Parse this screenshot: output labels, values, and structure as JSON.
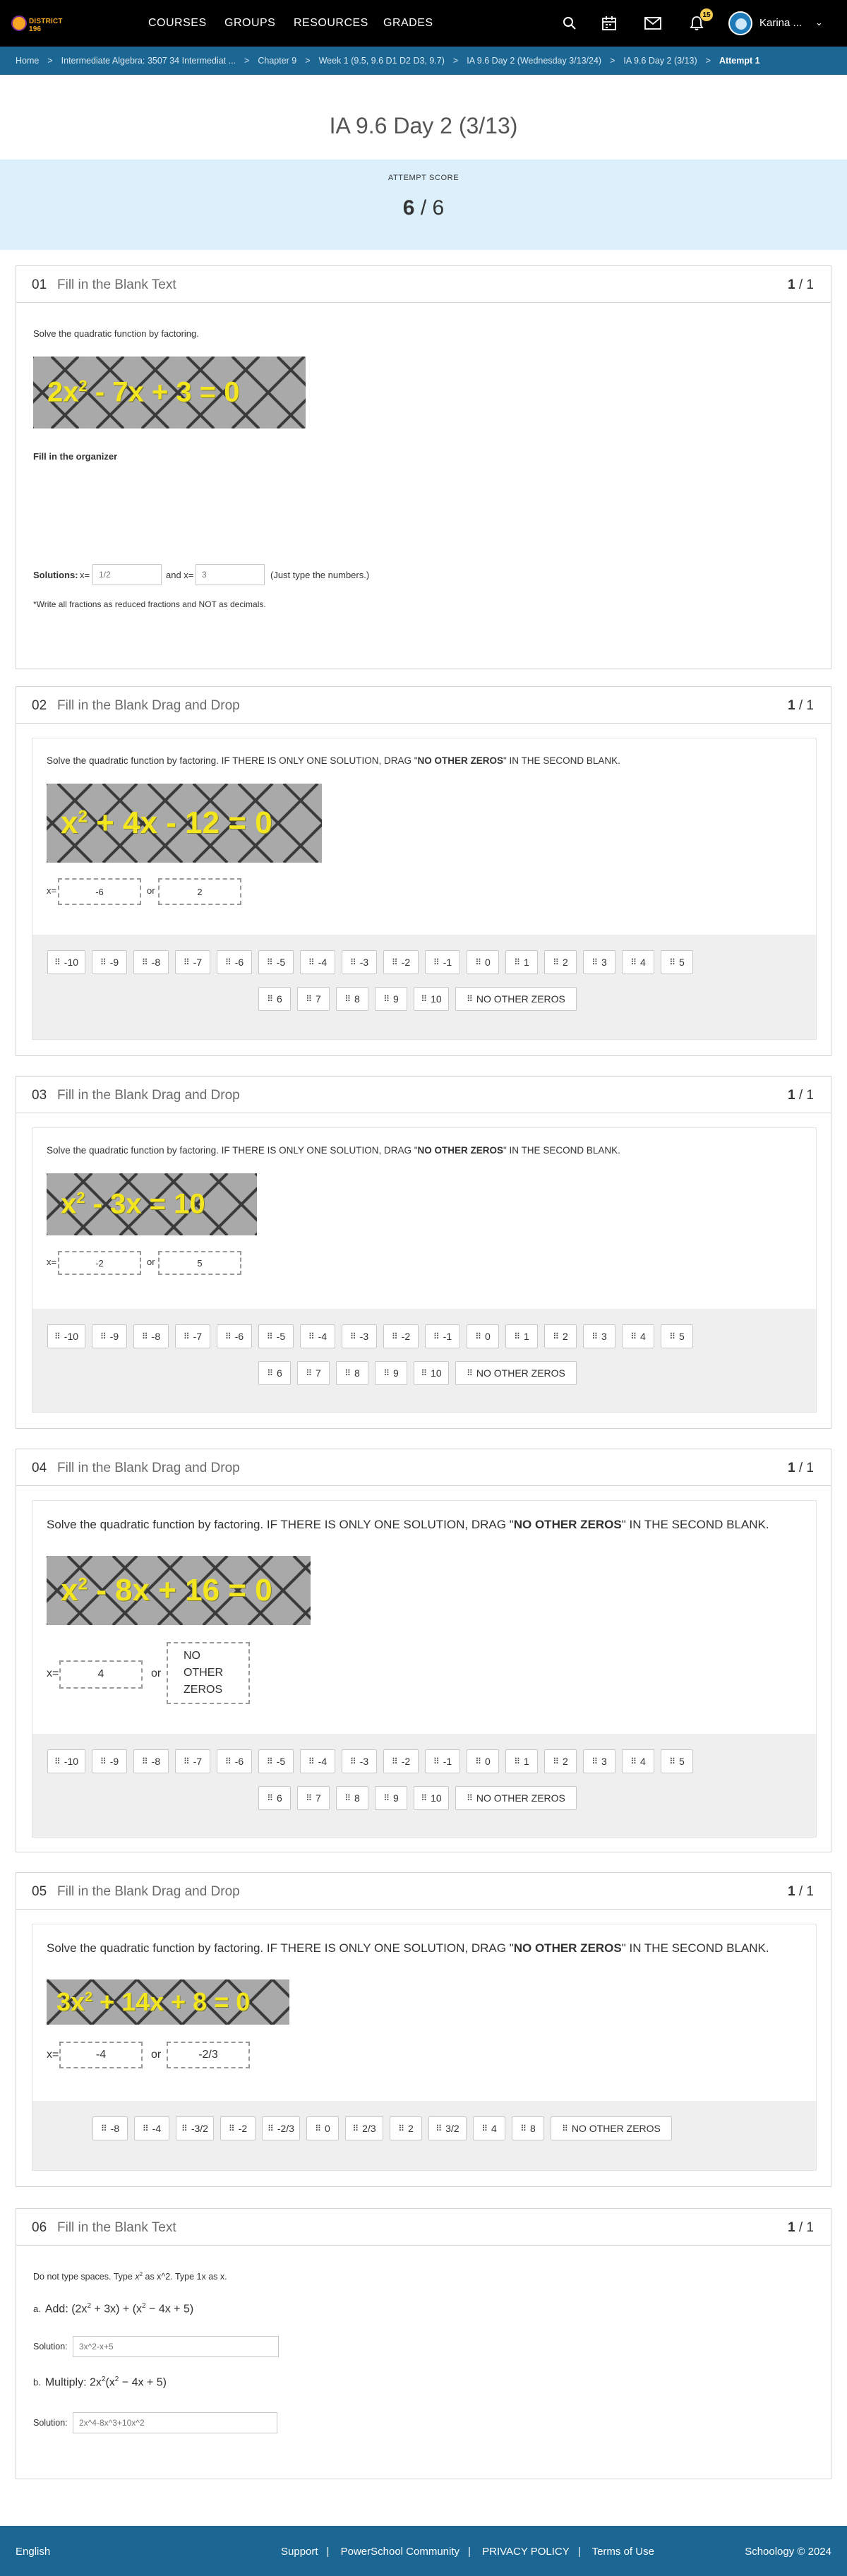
{
  "nav": {
    "logo_text": "DISTRICT 196",
    "items": [
      "COURSES",
      "GROUPS",
      "RESOURCES",
      "GRADES"
    ],
    "notif_count": "15",
    "user_name": "Karina ..."
  },
  "breadcrumb": [
    "Home",
    "Intermediate Algebra: 3507 34 Intermediat ...",
    "Chapter 9",
    "Week 1 (9.5, 9.6 D1 D2 D3, 9.7)",
    "IA 9.6 Day 2 (Wednesday 3/13/24)",
    "IA 9.6 Day 2 (3/13)",
    "Attempt 1"
  ],
  "page": {
    "title": "IA 9.6 Day 2 (3/13)",
    "score_label": "ATTEMPT SCORE",
    "score_earned": "6",
    "score_total": "/ 6"
  },
  "questions": [
    {
      "num": "01",
      "type": "Fill in the Blank Text",
      "score_earned": "1",
      "score_total": "/ 1",
      "prompt": "Solve the quadratic function by factoring.",
      "equation": {
        "base": "2x",
        "exp": "2",
        "rest": " - 7x + 3 = 0"
      },
      "organizer_label": "Fill in the organizer",
      "solutions_label": "Solutions:",
      "x1_label": "x=",
      "x1_placeholder": "1/2",
      "and_label": "and x=",
      "x2_placeholder": "3",
      "hint": "(Just type the numbers.)",
      "note": "*Write all fractions as reduced fractions and NOT as decimals."
    },
    {
      "num": "02",
      "type": "Fill in the Blank Drag and Drop",
      "score_earned": "1",
      "score_total": "/ 1",
      "prompt_pre": "Solve the quadratic function by factoring. IF THERE IS ONLY ONE SOLUTION, DRAG \"",
      "prompt_bold": "NO OTHER ZEROS",
      "prompt_post": "\" IN THE SECOND BLANK.",
      "equation": {
        "base": "x",
        "exp": "2",
        "rest": " + 4x - 12 = 0"
      },
      "x_label": "x=",
      "or_label": "or",
      "answer1": "-6",
      "answer2": "2",
      "choices": [
        "-10",
        "-9",
        "-8",
        "-7",
        "-6",
        "-5",
        "-4",
        "-3",
        "-2",
        "-1",
        "0",
        "1",
        "2",
        "3",
        "4",
        "5",
        "6",
        "7",
        "8",
        "9",
        "10",
        "NO OTHER ZEROS"
      ]
    },
    {
      "num": "03",
      "type": "Fill in the Blank Drag and Drop",
      "score_earned": "1",
      "score_total": "/ 1",
      "prompt_pre": "Solve the quadratic function by factoring. IF THERE IS ONLY ONE SOLUTION, DRAG \"",
      "prompt_bold": "NO OTHER ZEROS",
      "prompt_post": "\" IN THE SECOND BLANK.",
      "equation": {
        "base": "x",
        "exp": "2",
        "rest": " - 3x = 10"
      },
      "x_label": "x=",
      "or_label": "or",
      "answer1": "-2",
      "answer2": "5",
      "choices": [
        "-10",
        "-9",
        "-8",
        "-7",
        "-6",
        "-5",
        "-4",
        "-3",
        "-2",
        "-1",
        "0",
        "1",
        "2",
        "3",
        "4",
        "5",
        "6",
        "7",
        "8",
        "9",
        "10",
        "NO OTHER ZEROS"
      ]
    },
    {
      "num": "04",
      "type": "Fill in the Blank Drag and Drop",
      "score_earned": "1",
      "score_total": "/ 1",
      "prompt_pre": "Solve the quadratic function by factoring. IF THERE IS ONLY ONE SOLUTION, DRAG \"",
      "prompt_bold": "NO OTHER ZEROS",
      "prompt_post": "\" IN THE SECOND BLANK.",
      "equation": {
        "base": "x",
        "exp": "2",
        "rest": " - 8x + 16 = 0"
      },
      "x_label": "x=",
      "or_label": "or",
      "answer1": "4",
      "answer2": "NO OTHER ZEROS",
      "choices": [
        "-10",
        "-9",
        "-8",
        "-7",
        "-6",
        "-5",
        "-4",
        "-3",
        "-2",
        "-1",
        "0",
        "1",
        "2",
        "3",
        "4",
        "5",
        "6",
        "7",
        "8",
        "9",
        "10",
        "NO OTHER ZEROS"
      ]
    },
    {
      "num": "05",
      "type": "Fill in the Blank Drag and Drop",
      "score_earned": "1",
      "score_total": "/ 1",
      "prompt_pre": "Solve the quadratic function by factoring. IF THERE IS ONLY ONE SOLUTION, DRAG \"",
      "prompt_bold": "NO OTHER ZEROS",
      "prompt_post": "\" IN THE SECOND BLANK.",
      "equation": {
        "base": "3x",
        "exp": "2",
        "rest": " + 14x + 8 = 0"
      },
      "x_label": "x=",
      "or_label": "or",
      "answer1": "-4",
      "answer2": "-2/3",
      "choices": [
        "-8",
        "-4",
        "-3/2",
        "-2",
        "-2/3",
        "0",
        "2/3",
        "2",
        "3/2",
        "4",
        "8",
        "NO OTHER ZEROS"
      ]
    },
    {
      "num": "06",
      "type": "Fill in the Blank Text",
      "score_earned": "1",
      "score_total": "/ 1",
      "instr_pre": "Do not type spaces.  Type ",
      "instr_x": "x",
      "instr_exp": "2",
      "instr_post": " as x^2.  Type 1x as x.",
      "part_a_letter": "a.",
      "part_a_text": "Add:  (2x",
      "part_a_exp": "2",
      "part_a_text2": " + 3x) + (x",
      "part_a_exp2": "2",
      "part_a_text3": " − 4x + 5)",
      "solution_label": "Solution:",
      "part_a_placeholder": "3x^2-x+5",
      "part_b_letter": "b.",
      "part_b_text": "Multiply:  2x",
      "part_b_exp": "2",
      "part_b_text2": "(x",
      "part_b_exp2": "2",
      "part_b_text3": " − 4x + 5)",
      "part_b_placeholder": "2x^4-8x^3+10x^2"
    }
  ],
  "footer": {
    "language": "English",
    "links": [
      "Support",
      "PowerSchool Community",
      "PRIVACY POLICY",
      "Terms of Use"
    ],
    "copyright": "Schoology © 2024"
  },
  "colors": {
    "nav_bg": "#000000",
    "breadcrumb_bg": "#1c6694",
    "score_band": "#dcf0fb",
    "equation_text": "#f4e61e",
    "tray_bg": "#efefef"
  }
}
